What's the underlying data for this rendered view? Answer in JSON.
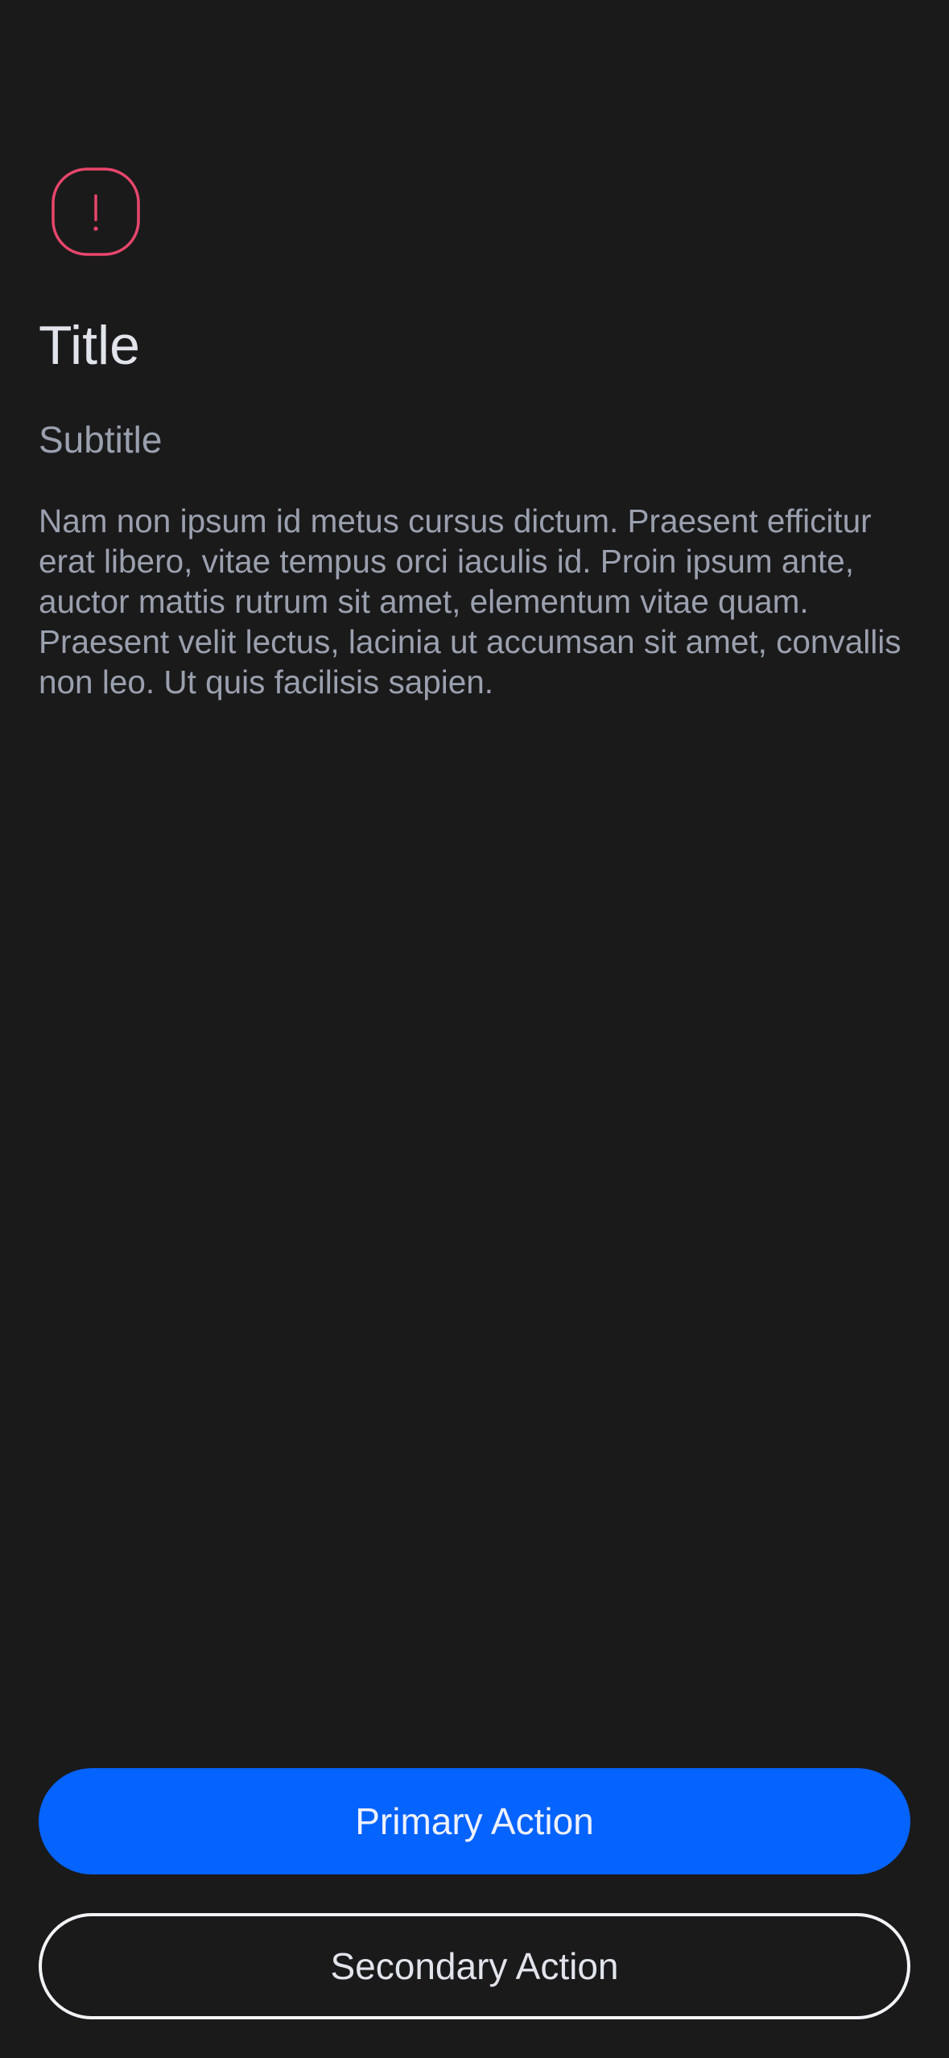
{
  "colors": {
    "background": "#1a1a1b",
    "alert_icon": "#e8466b",
    "primary_button": "#0563ff",
    "title_text": "#e2e4ec",
    "secondary_text": "#9aa0ae"
  },
  "alert": {
    "icon": "exclamation-icon",
    "glyph": "!"
  },
  "header": {
    "title": "Title",
    "subtitle": "Subtitle"
  },
  "body": {
    "text": "Nam non ipsum id metus cursus dictum. Praesent efficitur erat libero, vitae tempus orci iaculis id. Proin ipsum ante, auctor mattis rutrum sit amet, elementum vitae quam. Praesent velit lectus, lacinia ut accumsan sit amet, convallis non leo. Ut quis facilisis sapien."
  },
  "actions": {
    "primary_label": "Primary Action",
    "secondary_label": "Secondary Action"
  }
}
